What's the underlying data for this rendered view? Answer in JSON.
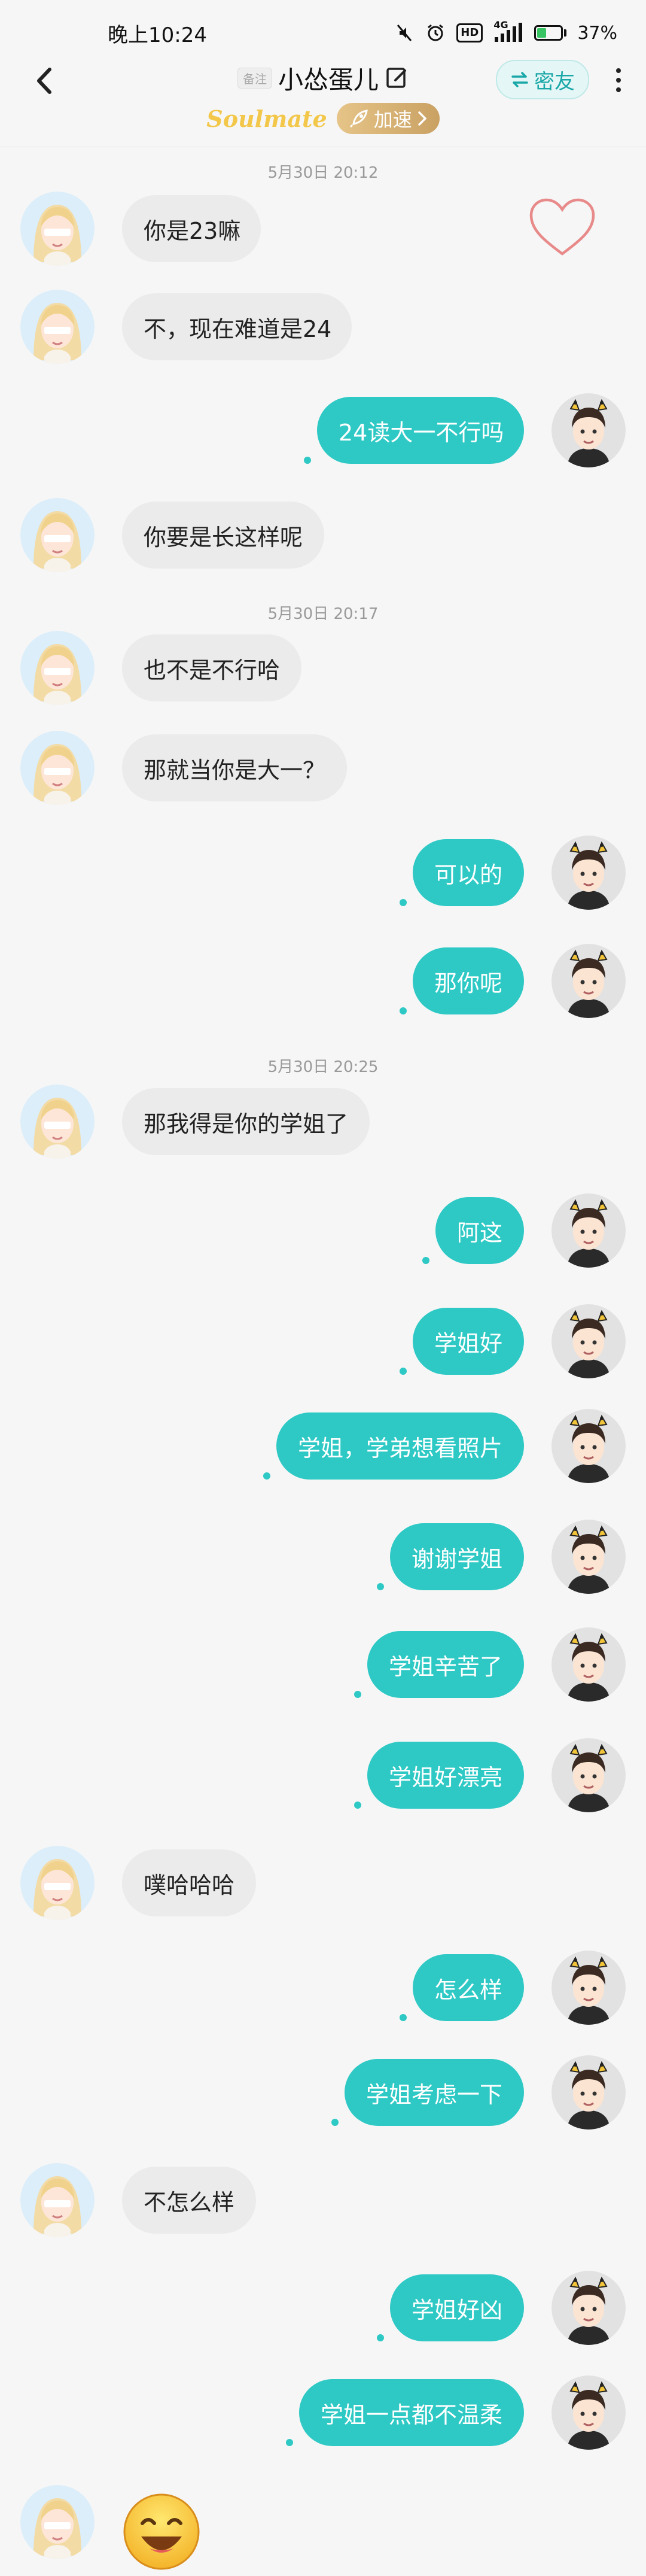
{
  "status_bar": {
    "time": "晚上10:24",
    "network": "4G",
    "hd": "HD",
    "battery": "37%",
    "battery_level": 0.37
  },
  "header": {
    "remark_tag": "备注",
    "title": "小怂蛋儿",
    "close_friend_label": "密友",
    "soulmate_text": "Soulmate",
    "speed_label": "加速"
  },
  "colors": {
    "accent": "#2ec9c5",
    "incoming_bubble": "#ebebeb",
    "soulmate": "#f2c74a"
  },
  "icons": [
    "back-arrow-icon",
    "edit-icon",
    "swap-icon",
    "more-icon",
    "heart-icon",
    "rocket-icon",
    "chevron-right-icon",
    "smile-emoji-icon"
  ],
  "messages": [
    {
      "type": "time",
      "text": "5月30日 20:12"
    },
    {
      "type": "in",
      "text": "你是23嘛"
    },
    {
      "type": "in",
      "text": "不，现在难道是24"
    },
    {
      "type": "out",
      "text": "24读大一不行吗"
    },
    {
      "type": "in",
      "text": "你要是长这样呢"
    },
    {
      "type": "time",
      "text": "5月30日 20:17"
    },
    {
      "type": "in",
      "text": "也不是不行哈"
    },
    {
      "type": "in",
      "text": "那就当你是大一？"
    },
    {
      "type": "out",
      "text": "可以的"
    },
    {
      "type": "out",
      "text": "那你呢"
    },
    {
      "type": "time",
      "text": "5月30日 20:25"
    },
    {
      "type": "in",
      "text": "那我得是你的学姐了"
    },
    {
      "type": "out",
      "text": "阿这"
    },
    {
      "type": "out",
      "text": "学姐好"
    },
    {
      "type": "out",
      "text": "学姐，学弟想看照片"
    },
    {
      "type": "out",
      "text": "谢谢学姐"
    },
    {
      "type": "out",
      "text": "学姐辛苦了"
    },
    {
      "type": "out",
      "text": "学姐好漂亮"
    },
    {
      "type": "in",
      "text": "噗哈哈哈"
    },
    {
      "type": "out",
      "text": "怎么样"
    },
    {
      "type": "out",
      "text": "学姐考虑一下"
    },
    {
      "type": "in",
      "text": "不怎么样"
    },
    {
      "type": "out",
      "text": "学姐好凶"
    },
    {
      "type": "out",
      "text": "学姐一点都不温柔"
    },
    {
      "type": "in",
      "text": ""
    }
  ]
}
